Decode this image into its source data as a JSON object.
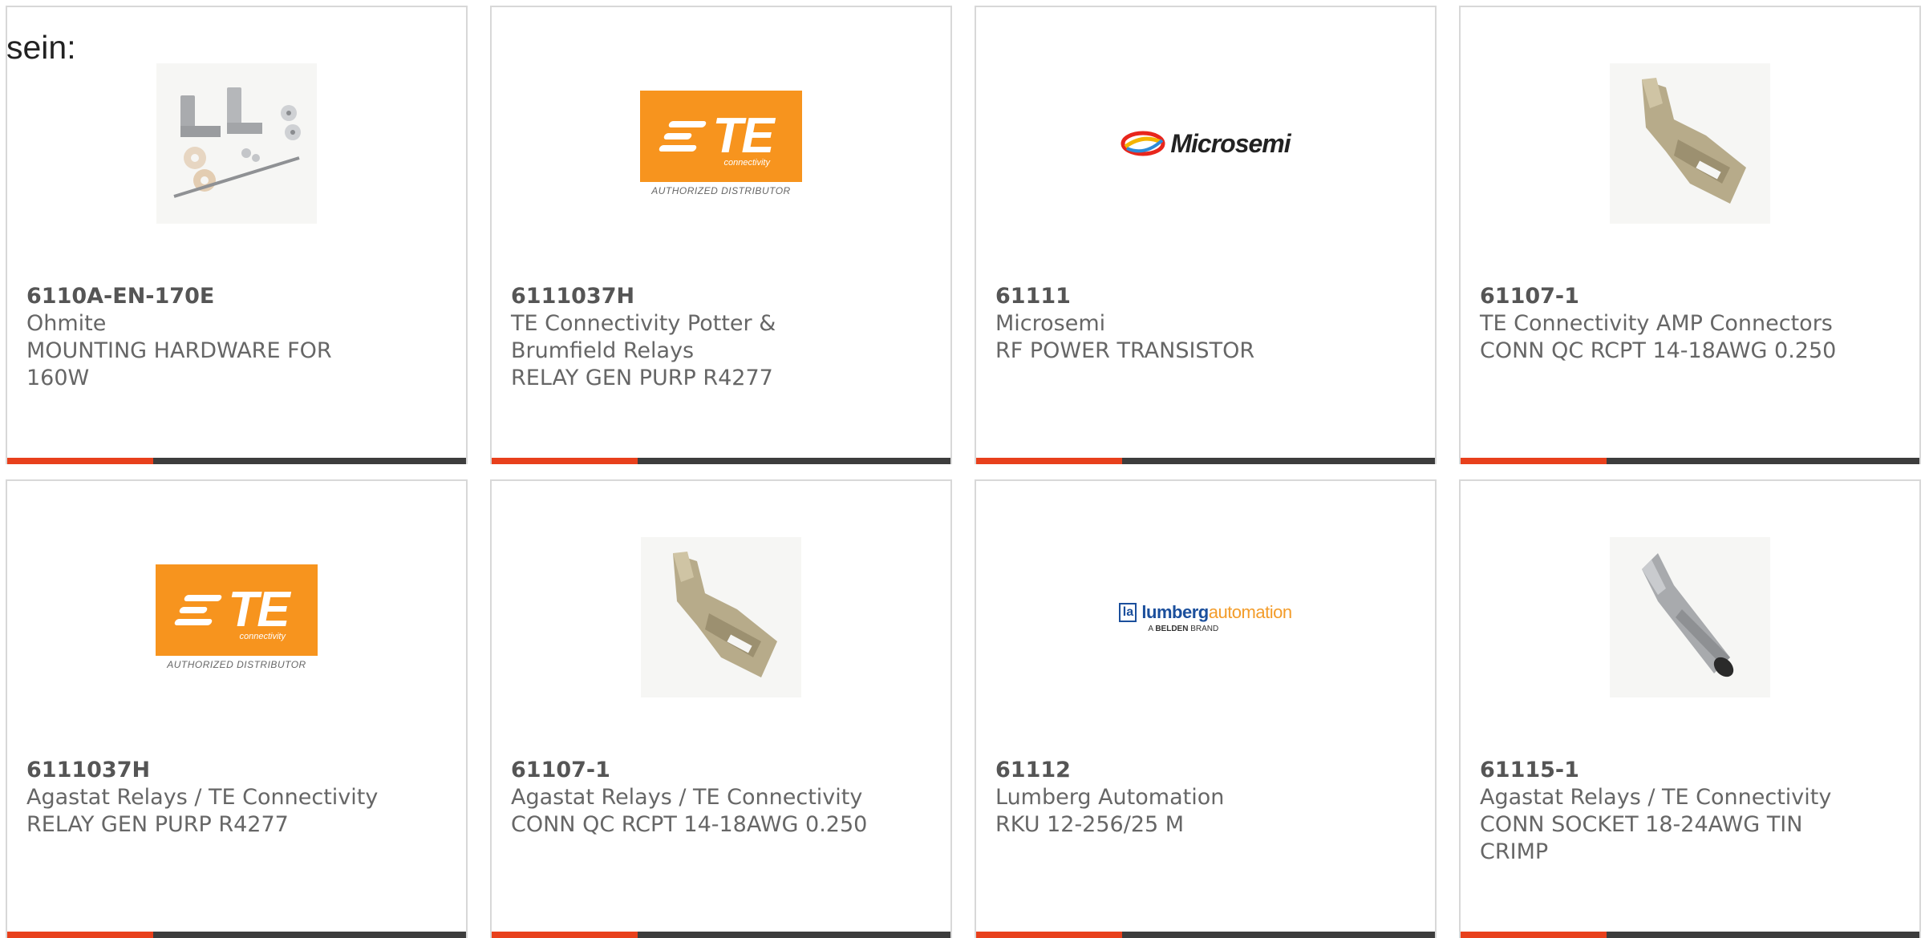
{
  "lead_text": "sein:",
  "brand_colors": {
    "accent_red": "#e8401c",
    "bar_dark": "#3d3d3d",
    "te_orange": "#f7941e"
  },
  "cards": [
    {
      "sku": "6110A-EN-170E",
      "brand": "Ohmite",
      "description": "MOUNTING HARDWARE FOR 160W",
      "image": "mounting-hardware-photo"
    },
    {
      "sku": "6111037H",
      "brand": "TE Connectivity Potter & Brumfield Relays",
      "description": "RELAY GEN PURP R4277",
      "image": "te-connectivity-logo",
      "logo": {
        "word": "TE",
        "sub": "connectivity",
        "tagline": "AUTHORIZED DISTRIBUTOR"
      }
    },
    {
      "sku": "61111",
      "brand": "Microsemi",
      "description": "RF POWER TRANSISTOR",
      "image": "microsemi-logo",
      "logo": {
        "word": "Microsemi"
      }
    },
    {
      "sku": "61107-1",
      "brand": "TE Connectivity AMP Connectors",
      "description": "CONN QC RCPT 14-18AWG 0.250",
      "image": "quick-connect-receptacle-photo"
    },
    {
      "sku": "6111037H",
      "brand": "Agastat Relays / TE Connectivity",
      "description": "RELAY GEN PURP R4277",
      "image": "te-connectivity-logo",
      "logo": {
        "word": "TE",
        "sub": "connectivity",
        "tagline": "AUTHORIZED DISTRIBUTOR"
      }
    },
    {
      "sku": "61107-1",
      "brand": "Agastat Relays / TE Connectivity",
      "description": "CONN QC RCPT 14-18AWG 0.250",
      "image": "quick-connect-receptacle-photo"
    },
    {
      "sku": "61112",
      "brand": "Lumberg Automation",
      "description": "RKU 12-256/25 M",
      "image": "lumberg-automation-logo",
      "logo": {
        "mark": "la",
        "word_a": "lumberg",
        "word_b": "automation",
        "sub_prefix": "A",
        "sub_bold": "BELDEN",
        "sub_suffix": "BRAND"
      }
    },
    {
      "sku": "61115-1",
      "brand": "Agastat Relays / TE Connectivity",
      "description": "CONN SOCKET 18-24AWG TIN CRIMP",
      "image": "crimp-socket-contact-photo"
    }
  ]
}
